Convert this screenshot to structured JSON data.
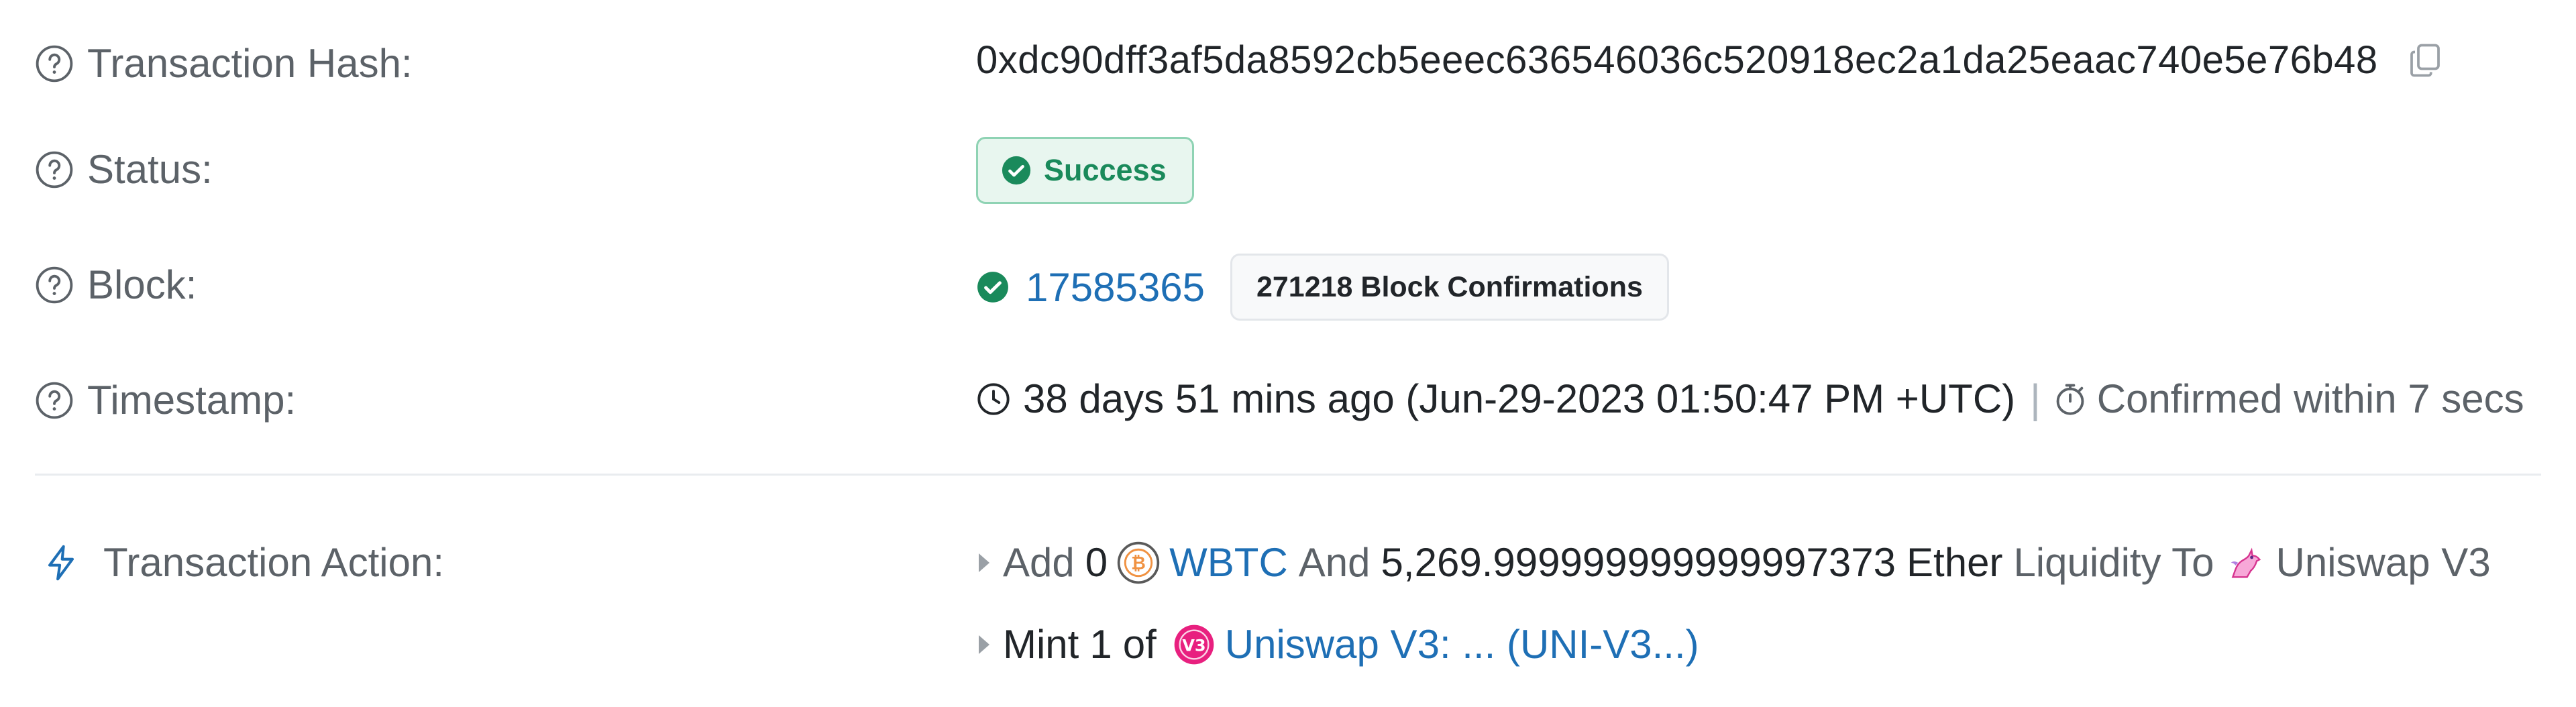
{
  "hash": {
    "label": "Transaction Hash:",
    "value": "0xdc90dff3af5da8592cb5eeec636546036c520918ec2a1da25eaac740e5e76b48"
  },
  "status": {
    "label": "Status:",
    "value": "Success",
    "color": "#1a8a5b"
  },
  "block": {
    "label": "Block:",
    "number": "17585365",
    "confirmations": "271218 Block Confirmations"
  },
  "timestamp": {
    "label": "Timestamp:",
    "relative": "38 days 51 mins ago (Jun-29-2023 01:50:47 PM +UTC)",
    "separator": "|",
    "confirmed": "Confirmed within 7 secs"
  },
  "action": {
    "label": "Transaction Action:",
    "line1": {
      "add": "Add",
      "amount": "0",
      "token": "WBTC",
      "and": "And",
      "ether_amount": "5,269.999999999999997373",
      "ether": "Ether",
      "liquidity_to": "Liquidity To",
      "protocol": "Uniswap V3"
    },
    "line2": {
      "mint": "Mint",
      "count": "1",
      "of": "of",
      "nft": "Uniswap V3: ... (UNI-V3...)"
    }
  },
  "colors": {
    "link": "#1e6fb5",
    "muted": "#5c6268",
    "success_bg": "#e8f6ef",
    "success_border": "#8fd3b4"
  }
}
